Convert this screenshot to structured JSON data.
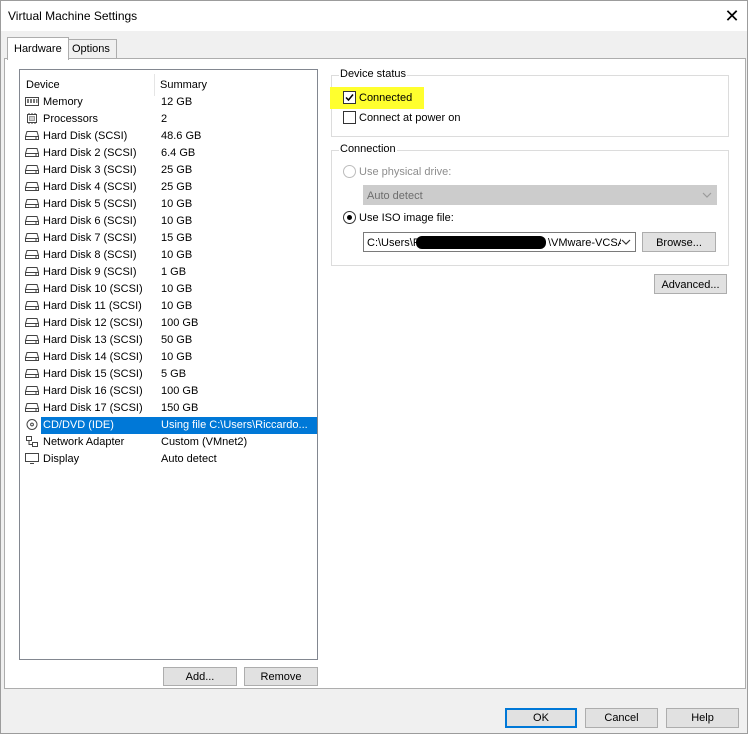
{
  "window": {
    "title": "Virtual Machine Settings",
    "close_label": "✕"
  },
  "tabs": [
    {
      "label": "Hardware",
      "active": true
    },
    {
      "label": "Options",
      "active": false
    }
  ],
  "device_list": {
    "columns": [
      "Device",
      "Summary"
    ],
    "rows": [
      {
        "icon": "memory-icon",
        "device": "Memory",
        "summary": "12 GB"
      },
      {
        "icon": "processor-icon",
        "device": "Processors",
        "summary": "2"
      },
      {
        "icon": "hard-disk-icon",
        "device": "Hard Disk (SCSI)",
        "summary": "48.6 GB"
      },
      {
        "icon": "hard-disk-icon",
        "device": "Hard Disk 2 (SCSI)",
        "summary": "6.4 GB"
      },
      {
        "icon": "hard-disk-icon",
        "device": "Hard Disk 3 (SCSI)",
        "summary": "25 GB"
      },
      {
        "icon": "hard-disk-icon",
        "device": "Hard Disk 4 (SCSI)",
        "summary": "25 GB"
      },
      {
        "icon": "hard-disk-icon",
        "device": "Hard Disk 5 (SCSI)",
        "summary": "10 GB"
      },
      {
        "icon": "hard-disk-icon",
        "device": "Hard Disk 6 (SCSI)",
        "summary": "10 GB"
      },
      {
        "icon": "hard-disk-icon",
        "device": "Hard Disk 7 (SCSI)",
        "summary": "15 GB"
      },
      {
        "icon": "hard-disk-icon",
        "device": "Hard Disk 8 (SCSI)",
        "summary": "10 GB"
      },
      {
        "icon": "hard-disk-icon",
        "device": "Hard Disk 9 (SCSI)",
        "summary": "1 GB"
      },
      {
        "icon": "hard-disk-icon",
        "device": "Hard Disk 10 (SCSI)",
        "summary": "10 GB"
      },
      {
        "icon": "hard-disk-icon",
        "device": "Hard Disk 11 (SCSI)",
        "summary": "10 GB"
      },
      {
        "icon": "hard-disk-icon",
        "device": "Hard Disk 12 (SCSI)",
        "summary": "100 GB"
      },
      {
        "icon": "hard-disk-icon",
        "device": "Hard Disk 13 (SCSI)",
        "summary": "50 GB"
      },
      {
        "icon": "hard-disk-icon",
        "device": "Hard Disk 14 (SCSI)",
        "summary": "10 GB"
      },
      {
        "icon": "hard-disk-icon",
        "device": "Hard Disk 15 (SCSI)",
        "summary": "5 GB"
      },
      {
        "icon": "hard-disk-icon",
        "device": "Hard Disk 16 (SCSI)",
        "summary": "100 GB"
      },
      {
        "icon": "hard-disk-icon",
        "device": "Hard Disk 17 (SCSI)",
        "summary": "150 GB"
      },
      {
        "icon": "cd-dvd-icon",
        "device": "CD/DVD (IDE)",
        "summary": "Using file C:\\Users\\Riccardo...",
        "selected": true
      },
      {
        "icon": "network-adapter-icon",
        "device": "Network Adapter",
        "summary": "Custom (VMnet2)"
      },
      {
        "icon": "display-icon",
        "device": "Display",
        "summary": "Auto detect"
      }
    ],
    "add_label": "Add...",
    "remove_label": "Remove"
  },
  "device_status": {
    "title": "Device status",
    "connected_label": "Connected",
    "connected_checked": true,
    "power_on_label": "Connect at power on",
    "power_on_checked": false
  },
  "connection": {
    "title": "Connection",
    "physical_label": "Use physical drive:",
    "physical_value": "Auto detect",
    "iso_label": "Use ISO image file:",
    "iso_path_start": "C:\\Users\\R",
    "iso_path_end": "\\VMware-VCSA",
    "browse_label": "Browse..."
  },
  "advanced_label": "Advanced...",
  "footer": {
    "ok_label": "OK",
    "cancel_label": "Cancel",
    "help_label": "Help"
  },
  "colors": {
    "selection": "#0078d7",
    "highlight": "#ffff2e",
    "dialog_bg": "#f0f0f0"
  }
}
